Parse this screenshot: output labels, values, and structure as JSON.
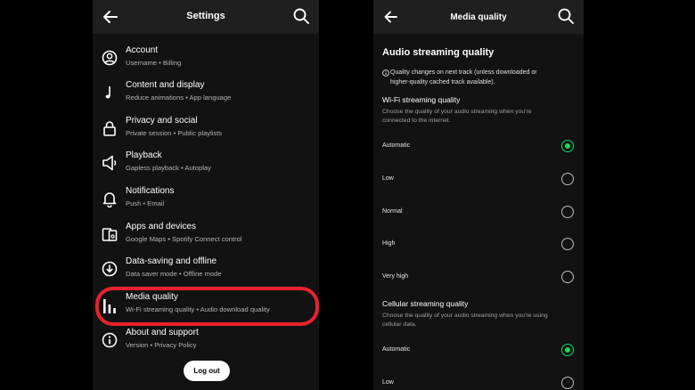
{
  "settings": {
    "title": "Settings",
    "items": [
      {
        "label": "Account",
        "sub": "Username • Billing",
        "icon": "account-icon"
      },
      {
        "label": "Content and display",
        "sub": "Reduce animations • App language",
        "icon": "music-note-icon"
      },
      {
        "label": "Privacy and social",
        "sub": "Private session • Public playlists",
        "icon": "lock-icon"
      },
      {
        "label": "Playback",
        "sub": "Gapless playback • Autoplay",
        "icon": "speaker-icon"
      },
      {
        "label": "Notifications",
        "sub": "Push • Email",
        "icon": "bell-icon"
      },
      {
        "label": "Apps and devices",
        "sub": "Google Maps • Spotify Connect control",
        "icon": "devices-icon"
      },
      {
        "label": "Data-saving and offline",
        "sub": "Data saver mode • Offline mode",
        "icon": "download-icon"
      },
      {
        "label": "Media quality",
        "sub": "Wi-Fi streaming quality • Audio download quality",
        "icon": "bars-icon"
      },
      {
        "label": "About and support",
        "sub": "Version • Privacy Policy",
        "icon": "info-icon"
      }
    ],
    "logout_label": "Log out"
  },
  "media": {
    "title": "Media quality",
    "section": "Audio streaming quality",
    "info_line1": "Quality changes on next track (unless downloaded or",
    "info_line2": "higher-quality cached track available).",
    "wifi": {
      "heading": "Wi-Fi streaming quality",
      "desc1": "Choose the quality of your audio streaming when you're",
      "desc2": "connected to the internet.",
      "options": [
        "Automatic",
        "Low",
        "Normal",
        "High",
        "Very high"
      ],
      "selected": "Automatic"
    },
    "cellular": {
      "heading": "Cellular streaming quality",
      "desc1": "Choose the quality of your audio streaming when you're using",
      "desc2": "cellular data.",
      "options": [
        "Automatic",
        "Low"
      ],
      "selected": "Automatic"
    }
  },
  "colors": {
    "accent": "#1ed760",
    "highlight": "#e8222e",
    "background": "#121212",
    "header": "#1f1f1f"
  }
}
